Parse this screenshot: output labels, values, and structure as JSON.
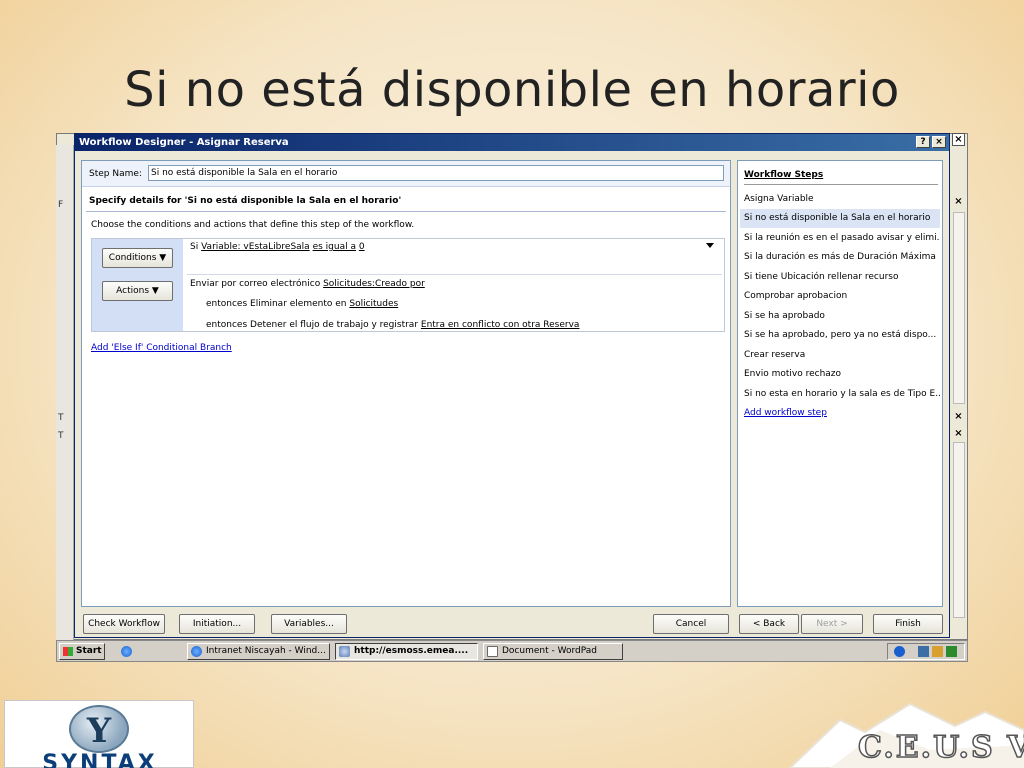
{
  "slide": {
    "title": "Si no está disponible en horario"
  },
  "window": {
    "title": "Workflow Designer - Asignar Reserva",
    "help_btn": "?",
    "close_btn": "×"
  },
  "background_app": {
    "left_labels": [
      "F",
      "T",
      "T"
    ],
    "close_glyph": "×"
  },
  "step": {
    "name_label": "Step Name:",
    "name_value": "Si no está disponible la Sala en el horario",
    "specify_heading": "Specify details for 'Si no está disponible la Sala en el horario'",
    "choose_text": "Choose the conditions and actions that define this step of the workflow."
  },
  "conditions": {
    "button_label": "Conditions ▼",
    "prefix": "Si",
    "variable": "Variable: vEstaLibreSala",
    "operator": "es igual a",
    "value": "0"
  },
  "actions": {
    "button_label": "Actions ▼",
    "action1_prefix": "Enviar por correo electrónico",
    "action1_link": "Solicitudes:Creado por",
    "action2_prefix": "entonces Eliminar elemento en",
    "action2_link": "Solicitudes",
    "action3_prefix": "entonces Detener el flujo de trabajo y registrar",
    "action3_link": "Entra en conflicto con otra Reserva"
  },
  "add_else_link": "Add 'Else If' Conditional Branch",
  "workflow_steps": {
    "header": "Workflow Steps",
    "items": [
      "Asigna Variable",
      "Si no está disponible la Sala en el horario",
      "Si la reunión es en el pasado avisar y elimi...",
      "Si la duración es más de Duración Máxima",
      "Si tiene Ubicación rellenar recurso",
      "Comprobar aprobacion",
      "Si se ha aprobado",
      "Si se ha aprobado, pero ya no está dispo...",
      "Crear reserva",
      "Envio motivo rechazo",
      "Si no esta en horario y la sala es de Tipo E..."
    ],
    "selected_index": 1,
    "add_link": "Add workflow step"
  },
  "bottom_buttons": {
    "check": "Check Workflow",
    "initiation": "Initiation...",
    "variables": "Variables...",
    "cancel": "Cancel",
    "back": "< Back",
    "next": "Next >",
    "finish": "Finish"
  },
  "taskbar": {
    "start": "Start",
    "items": [
      "Intranet Niscayah - Wind...",
      "http://esmoss.emea....",
      "Document - WordPad"
    ],
    "active_index": 1
  },
  "logos": {
    "syntax_mark": "Y",
    "syntax_text": "SYNTAX",
    "ceus_text": "C.E.U.S VI"
  }
}
